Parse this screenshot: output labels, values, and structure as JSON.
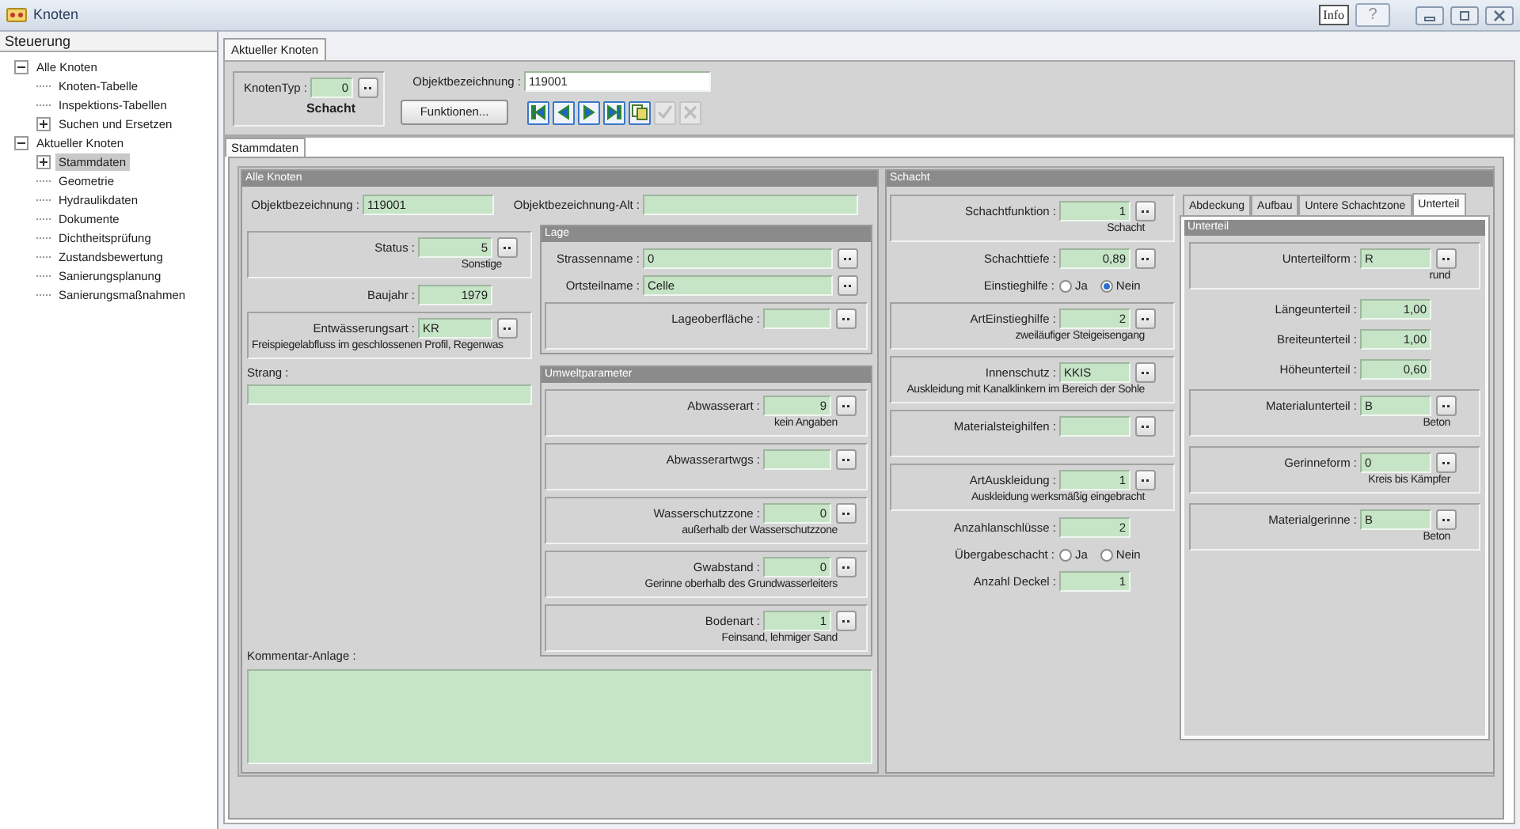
{
  "window": {
    "title": "Knoten",
    "info_button": "Info",
    "help_button": "?"
  },
  "sidebar": {
    "title": "Steuerung",
    "tree": [
      {
        "label": "Alle Knoten",
        "selected": false,
        "expanded": true,
        "children": [
          {
            "label": "Knoten-Tabelle",
            "selected": false
          },
          {
            "label": "Inspektions-Tabellen",
            "selected": false
          },
          {
            "label": "Suchen und Ersetzen",
            "selected": false,
            "expanded": false
          }
        ]
      },
      {
        "label": "Aktueller Knoten",
        "selected": false,
        "expanded": true,
        "children": [
          {
            "label": "Stammdaten",
            "selected": true,
            "expanded": false
          },
          {
            "label": "Geometrie",
            "selected": false
          },
          {
            "label": "Hydraulikdaten",
            "selected": false
          },
          {
            "label": "Dokumente",
            "selected": false
          },
          {
            "label": "Dichtheitsprüfung",
            "selected": false
          },
          {
            "label": "Zustandsbewertung",
            "selected": false
          },
          {
            "label": "Sanierungsplanung",
            "selected": false
          },
          {
            "label": "Sanierungsmaßnahmen",
            "selected": false
          }
        ]
      }
    ]
  },
  "main_tabs": [
    {
      "label": "Aktueller Knoten",
      "selected": true
    }
  ],
  "header": {
    "knotentyp": {
      "label": "KnotenTyp :",
      "value": "0",
      "description": "Schacht"
    },
    "objektbezeichnung": {
      "label": "Objektbezeichnung :",
      "value": "119001"
    },
    "functions_button": "Funktionen...",
    "navigation": [
      {
        "kind": "first",
        "disabled": false
      },
      {
        "kind": "previous",
        "disabled": false
      },
      {
        "kind": "next",
        "disabled": false
      },
      {
        "kind": "last",
        "disabled": false
      },
      {
        "kind": "copy",
        "disabled": false
      },
      {
        "kind": "save",
        "disabled": true
      },
      {
        "kind": "discard",
        "disabled": true
      }
    ]
  },
  "detail_tabs": [
    {
      "label": "Stammdaten",
      "selected": true
    }
  ],
  "alle_knoten": {
    "title": "Alle Knoten",
    "top_row": [
      {
        "kind": "field",
        "label": "Objektbezeichnung :",
        "value": "119001",
        "numeric": false,
        "lookup": false
      },
      {
        "kind": "field",
        "label": "Objektbezeichnung-Alt :",
        "lookup": false
      }
    ],
    "left_column": [
      {
        "kind": "boxed_field",
        "label": "Status :",
        "value": "5",
        "numeric": true,
        "lookup": true,
        "description": "Sonstige"
      },
      {
        "kind": "field",
        "label": "Baujahr :",
        "value": "1979",
        "numeric": true,
        "lookup": false
      },
      {
        "kind": "boxed_field",
        "label": "Entwässerungsart :",
        "value": "KR",
        "numeric": false,
        "lookup": true,
        "description": "Freispiegelabfluss im geschlossenen Profil, Regenwas"
      },
      {
        "kind": "stacked_field",
        "label": "Strang :"
      }
    ],
    "right_column": [
      {
        "title": "Lage",
        "items": [
          {
            "kind": "field",
            "label": "Strassenname :",
            "value": "0",
            "numeric": false,
            "lookup": true
          },
          {
            "kind": "field",
            "label": "Ortsteilname :",
            "value": "Celle",
            "numeric": false,
            "lookup": true
          },
          {
            "kind": "boxed_field",
            "label": "Lageoberfläche :",
            "lookup": true
          }
        ]
      },
      {
        "title": "Umweltparameter",
        "items": [
          {
            "kind": "boxed_field",
            "label": "Abwasserart :",
            "value": "9",
            "numeric": true,
            "lookup": true,
            "description": "kein Angaben"
          },
          {
            "kind": "boxed_field",
            "label": "Abwasserartwgs :",
            "lookup": true
          },
          {
            "kind": "boxed_field",
            "label": "Wasserschutzzone :",
            "value": "0",
            "numeric": true,
            "lookup": true,
            "description": "außerhalb der Wasserschutzzone"
          },
          {
            "kind": "boxed_field",
            "label": "Gwabstand :",
            "value": "0",
            "numeric": true,
            "lookup": true,
            "description": "Gerinne oberhalb des Grundwasserleiters"
          },
          {
            "kind": "boxed_field",
            "label": "Bodenart :",
            "value": "1",
            "numeric": true,
            "lookup": true,
            "description": "Feinsand, lehmiger Sand"
          }
        ]
      }
    ],
    "comment": {
      "label": "Kommentar-Anlage :"
    }
  },
  "schacht": {
    "title": "Schacht",
    "items": [
      {
        "kind": "boxed_field",
        "label": "Schachtfunktion :",
        "value": "1",
        "numeric": true,
        "lookup": true,
        "description": "Schacht"
      },
      {
        "kind": "field",
        "label": "Schachttiefe :",
        "value": "0,89",
        "numeric": true,
        "lookup": true
      },
      {
        "kind": "radio",
        "label": "Einstieghilfe :",
        "options": [
          {
            "label": "Ja",
            "selected": false
          },
          {
            "label": "Nein",
            "selected": true
          }
        ]
      },
      {
        "kind": "boxed_field",
        "label": "ArtEinstieghilfe :",
        "value": "2",
        "numeric": true,
        "lookup": true,
        "description": "zweiläufiger Steigeisengang"
      },
      {
        "kind": "boxed_field",
        "label": "Innenschutz :",
        "value": "KKIS",
        "numeric": false,
        "lookup": true,
        "description": "Auskleidung mit Kanalklinkern im Bereich der Sohle"
      },
      {
        "kind": "boxed_field",
        "label": "Materialsteighilfen :",
        "lookup": true
      },
      {
        "kind": "boxed_field",
        "label": "ArtAuskleidung :",
        "value": "1",
        "numeric": true,
        "lookup": true,
        "description": "Auskleidung werksmäßig eingebracht"
      },
      {
        "kind": "field",
        "label": "Anzahlanschlüsse :",
        "value": "2",
        "numeric": true,
        "lookup": false
      },
      {
        "kind": "radio",
        "label": "Übergabeschacht :",
        "options": [
          {
            "label": "Ja",
            "selected": false
          },
          {
            "label": "Nein",
            "selected": false
          }
        ]
      },
      {
        "kind": "field",
        "label": "Anzahl Deckel :",
        "value": "1",
        "numeric": true,
        "lookup": false
      }
    ],
    "tabs": [
      {
        "label": "Abdeckung",
        "selected": false
      },
      {
        "label": "Aufbau",
        "selected": false
      },
      {
        "label": "Untere Schachtzone",
        "selected": false
      },
      {
        "label": "Unterteil",
        "selected": true
      }
    ],
    "tab_panel": {
      "title": "Unterteil",
      "items": [
        {
          "kind": "boxed_field",
          "label": "Unterteilform :",
          "value": "R",
          "numeric": false,
          "lookup": true,
          "description": "rund"
        },
        {
          "kind": "field",
          "label": "Längeunterteil :",
          "value": "1,00",
          "numeric": true,
          "lookup": false
        },
        {
          "kind": "field",
          "label": "Breiteunterteil :",
          "value": "1,00",
          "numeric": true,
          "lookup": false
        },
        {
          "kind": "field",
          "label": "Höheunterteil :",
          "value": "0,60",
          "numeric": true,
          "lookup": false
        },
        {
          "kind": "boxed_field",
          "label": "Materialunterteil :",
          "value": "B",
          "numeric": false,
          "lookup": true,
          "description": "Beton"
        },
        {
          "kind": "boxed_field",
          "label": "Gerinneform :",
          "value": "0",
          "numeric": false,
          "lookup": true,
          "description": "Kreis bis Kämpfer"
        },
        {
          "kind": "boxed_field",
          "label": "Materialgerinne :",
          "value": "B",
          "numeric": false,
          "lookup": true,
          "description": "Beton"
        }
      ]
    }
  }
}
